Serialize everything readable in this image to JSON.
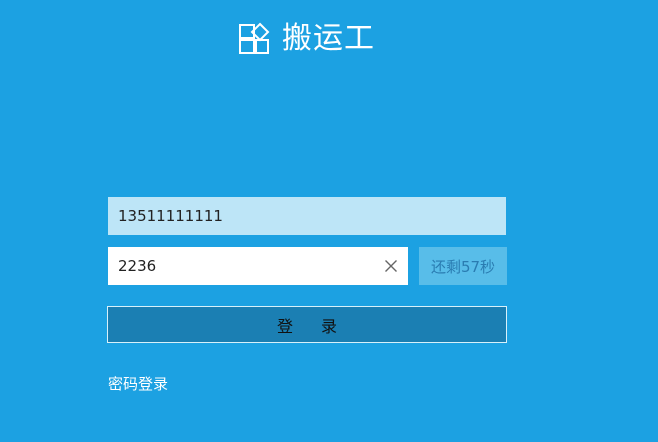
{
  "brand": {
    "title": "搬运工",
    "icon": "app-logo-icon"
  },
  "login_form": {
    "phone_value": "13511111111",
    "code_value": "2236",
    "countdown_label": "还剩57秒",
    "login_label": "登录",
    "password_login_label": "密码登录"
  },
  "colors": {
    "background": "#1ca1e2",
    "phone_field": "#bde5f7",
    "code_field": "#ffffff",
    "countdown_button": "#58bde9",
    "login_button": "#1b7fb3",
    "text_white": "#ffffff"
  },
  "icons": {
    "clear": "close-icon"
  }
}
